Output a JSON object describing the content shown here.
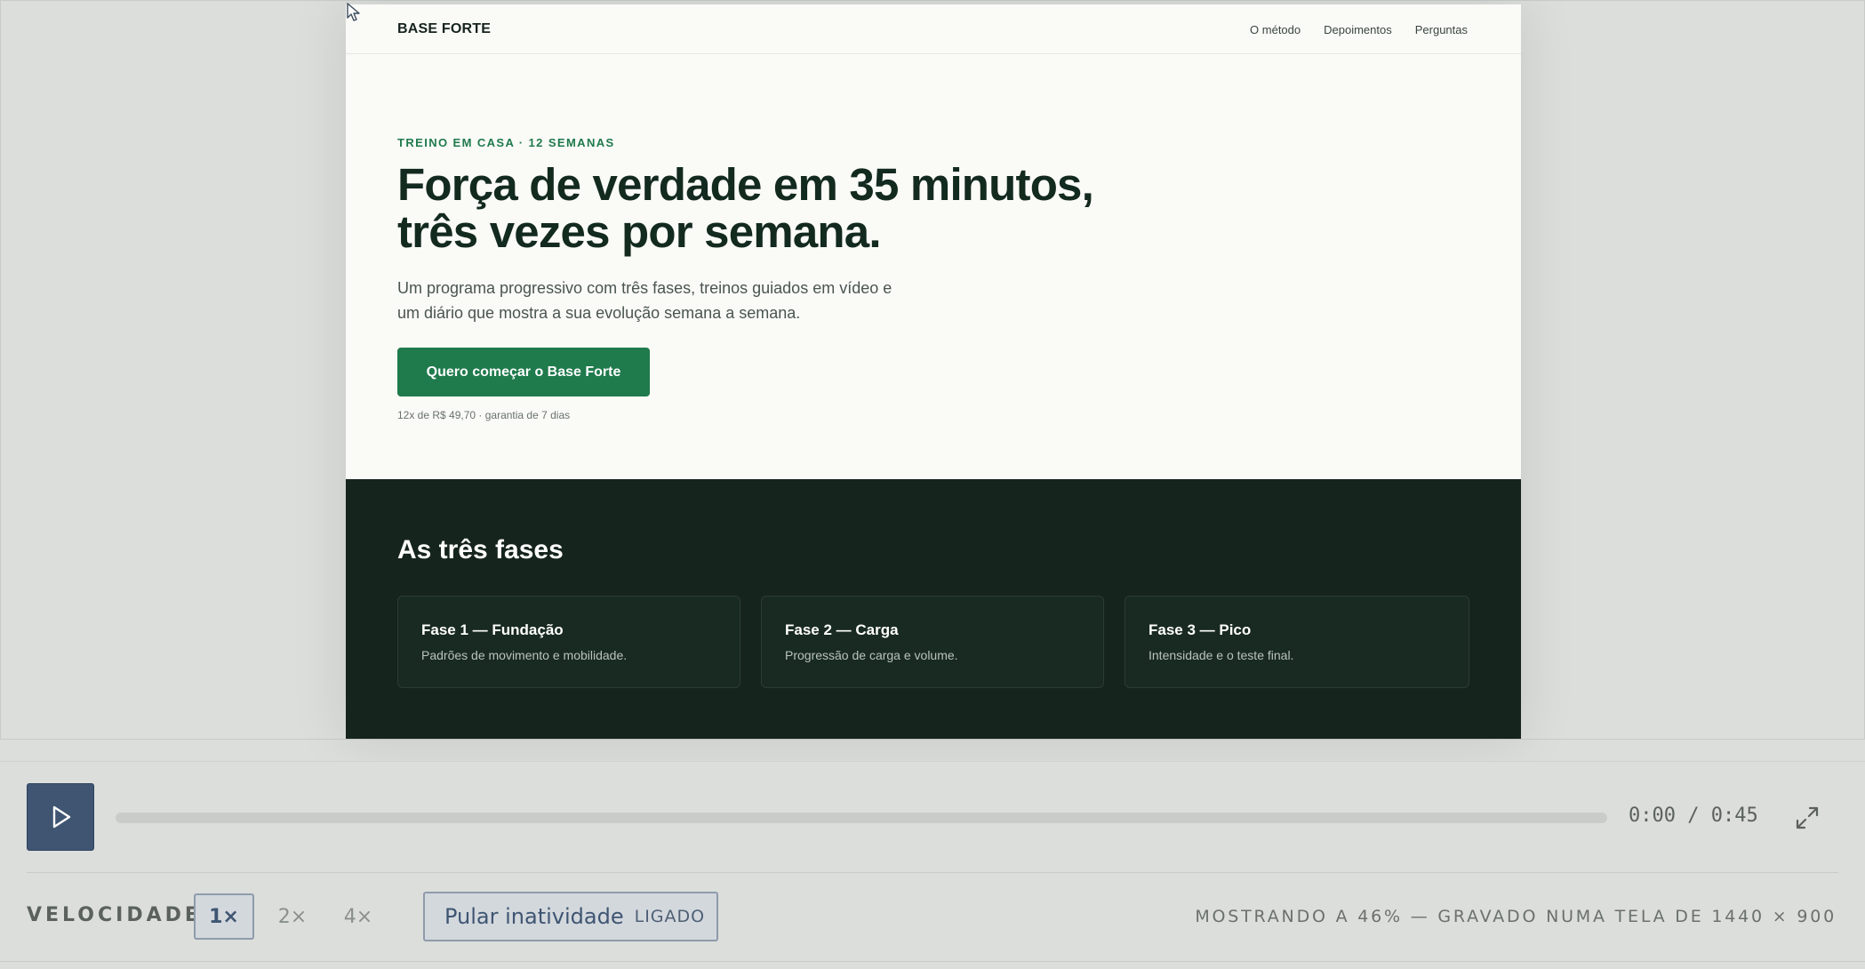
{
  "site": {
    "brand": "BASE FORTE",
    "nav": [
      {
        "label": "O método"
      },
      {
        "label": "Depoimentos"
      },
      {
        "label": "Perguntas"
      }
    ],
    "hero": {
      "eyebrow": "TREINO EM CASA · 12 SEMANAS",
      "headline_line1": "Força de verdade em 35 minutos,",
      "headline_line2": "três vezes por semana.",
      "subhead_line1": "Um programa progressivo com três fases, treinos guiados em vídeo e",
      "subhead_line2": "um diário que mostra a sua evolução semana a semana.",
      "cta_label": "Quero começar o Base Forte",
      "price_note": "12x de R$ 49,70 · garantia de 7 dias"
    },
    "phases": {
      "title": "As três fases",
      "items": [
        {
          "name": "Fase 1 — Fundação",
          "desc": "Padrões de movimento e mobilidade."
        },
        {
          "name": "Fase 2 — Carga",
          "desc": "Progressão de carga e volume."
        },
        {
          "name": "Fase 3 — Pico",
          "desc": "Intensidade e o teste final."
        }
      ]
    }
  },
  "player": {
    "progress": 0,
    "current_time": "0:00",
    "duration": "0:45",
    "time_readout": "0:00 / 0:45",
    "speed_label": "VELOCIDADE",
    "speeds": [
      {
        "label": "1×",
        "selected": true
      },
      {
        "label": "2×",
        "selected": false
      },
      {
        "label": "4×",
        "selected": false
      }
    ],
    "skip_inactivity": {
      "label": "Pular inatividade",
      "state": "LIGADO"
    },
    "scale_note": "MOSTRANDO A 46% — GRAVADO NUMA TELA DE 1440 × 900"
  },
  "colors": {
    "accent": "#1f7a4c",
    "dark_section": "#15241d",
    "player_accent": "#3f5572"
  },
  "icons": [
    "cursor-icon",
    "play-icon",
    "fullscreen-icon"
  ]
}
